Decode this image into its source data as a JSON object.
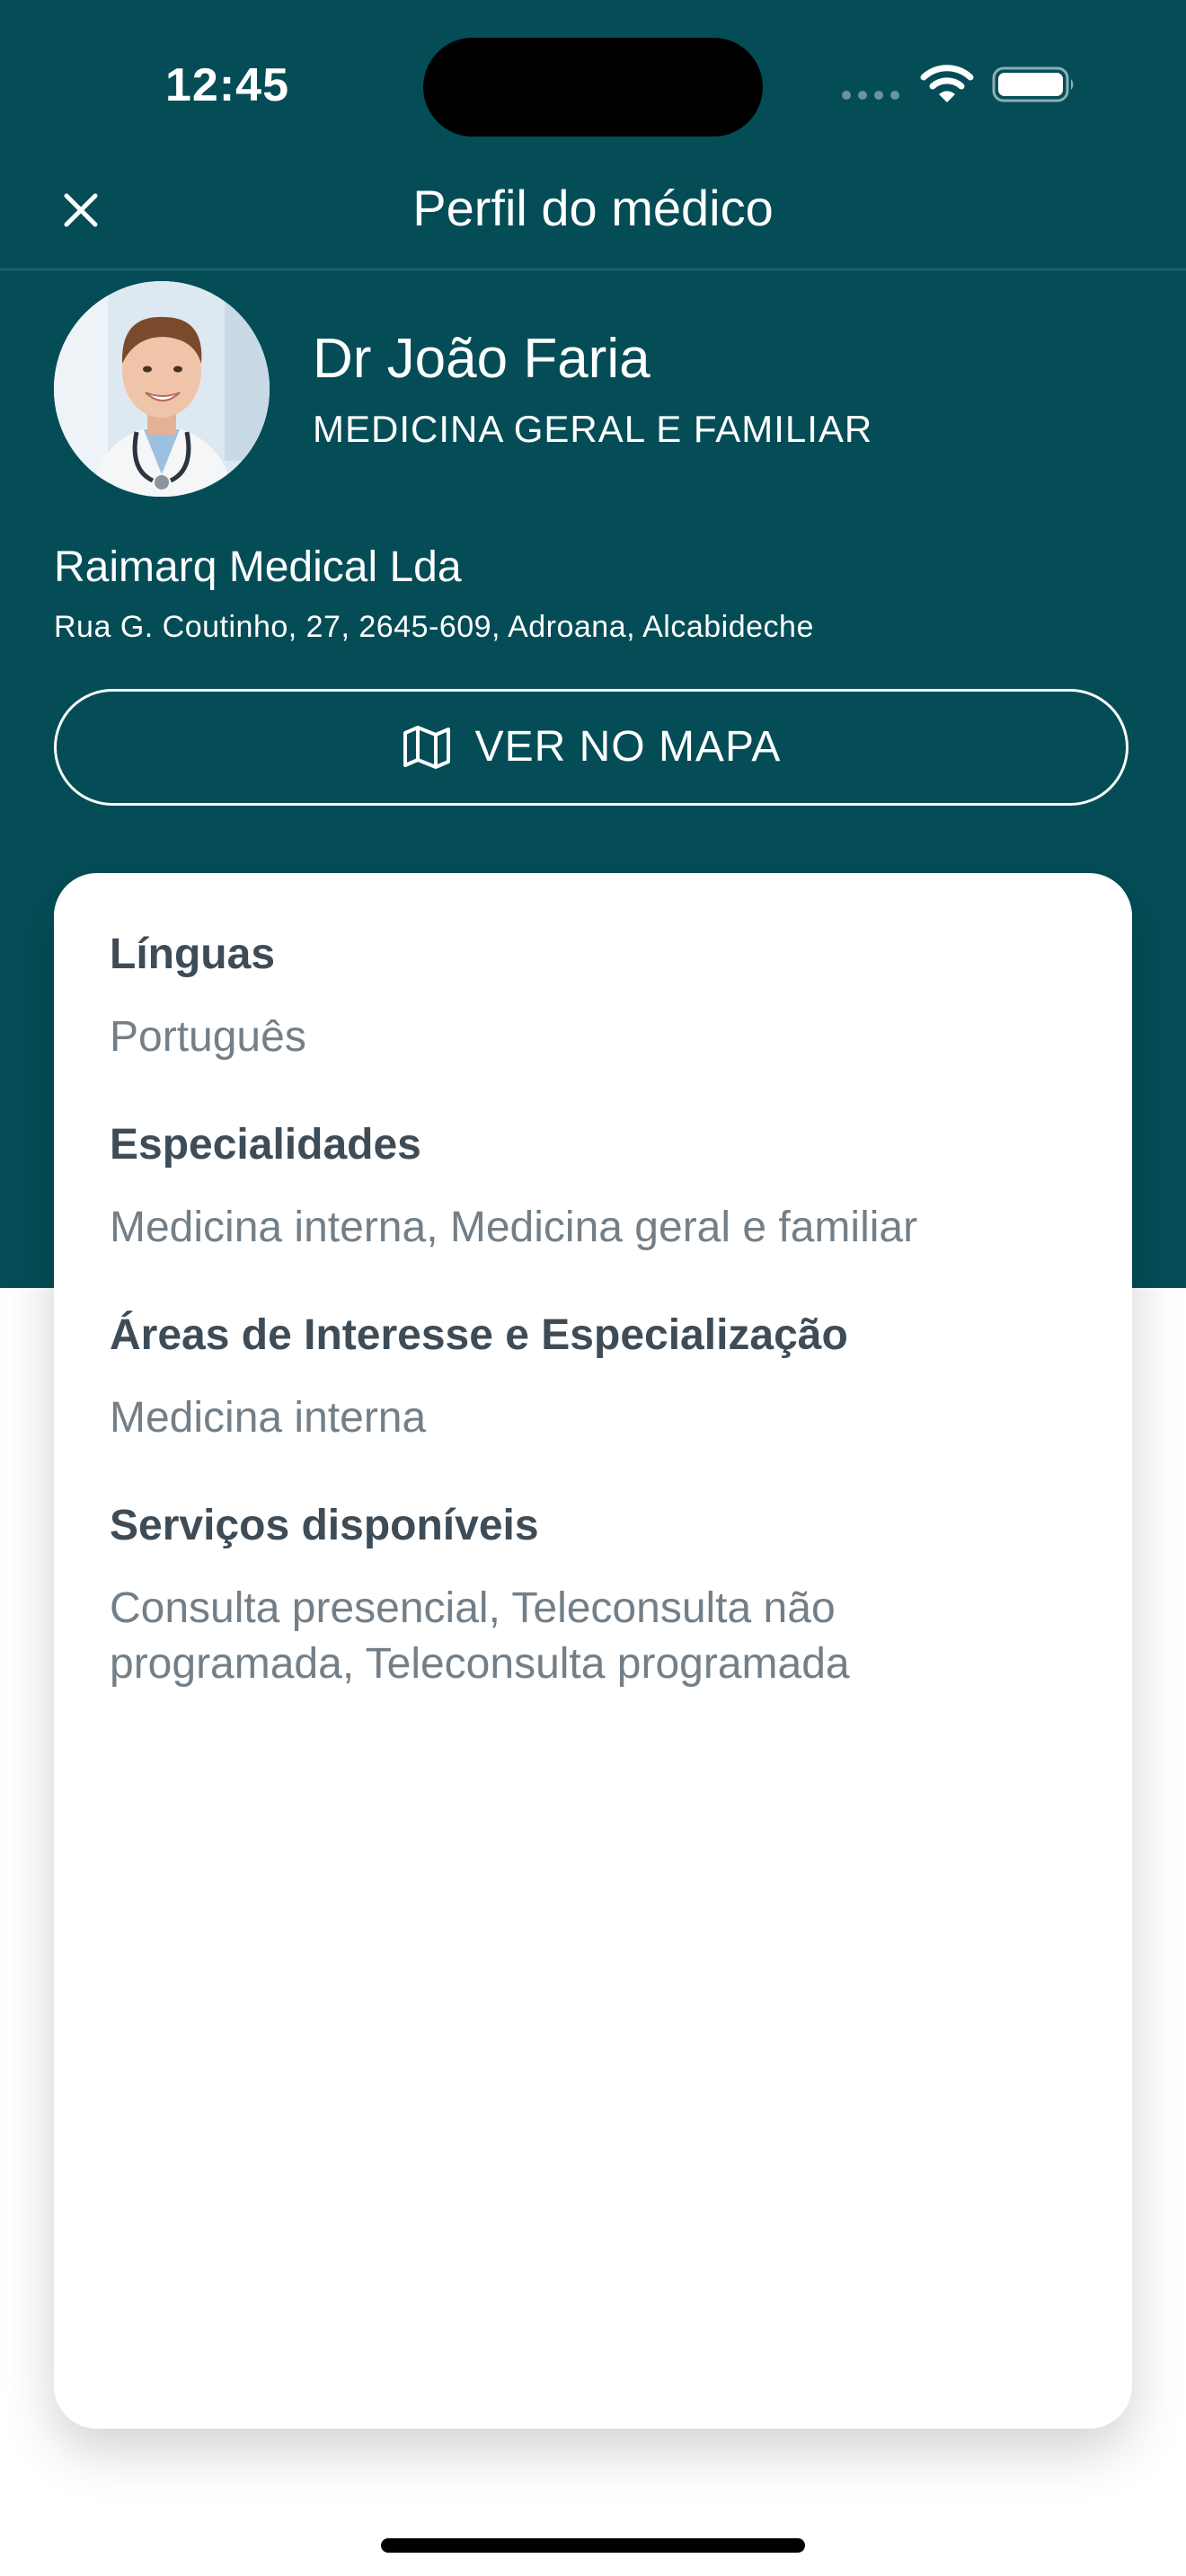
{
  "status_bar": {
    "time": "12:45"
  },
  "header": {
    "title": "Perfil do médico"
  },
  "doctor": {
    "name": "Dr João Faria",
    "specialty": "MEDICINA GERAL E FAMILIAR",
    "clinic_name": "Raimarq Medical Lda",
    "clinic_address": "Rua G. Coutinho, 27, 2645-609, Adroana, Alcabideche"
  },
  "map_button": {
    "label": "VER NO MAPA",
    "icon": "map-icon"
  },
  "details": {
    "sections": [
      {
        "title": "Línguas",
        "value": "Português"
      },
      {
        "title": "Especialidades",
        "value": "Medicina interna, Medicina geral e familiar"
      },
      {
        "title": "Áreas de Interesse e Especialização",
        "value": "Medicina interna"
      },
      {
        "title": "Serviços disponíveis",
        "value": "Consulta presencial, Teleconsulta não programada, Teleconsulta programada"
      }
    ]
  },
  "colors": {
    "header_background": "#044d57",
    "title_text": "#3e4c57",
    "value_text": "#737f88"
  }
}
